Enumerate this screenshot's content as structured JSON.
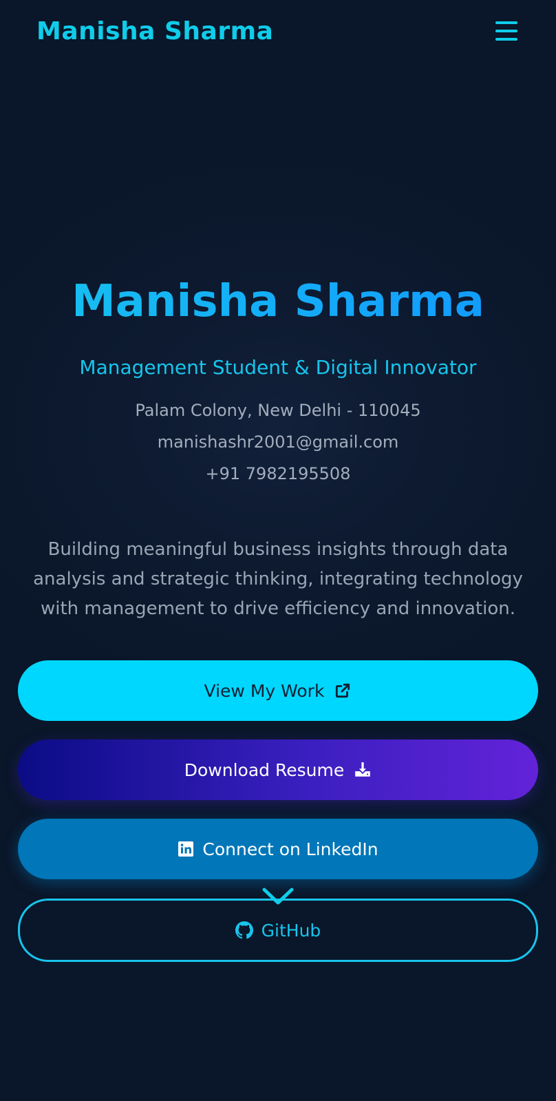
{
  "header": {
    "brand": "Manisha Sharma",
    "menu_icon": "hamburger-menu-icon"
  },
  "hero": {
    "name": "Manisha Sharma",
    "tagline": "Management Student & Digital Innovator",
    "address": "Palam Colony, New Delhi - 110045",
    "email": "manishashr2001@gmail.com",
    "phone": "+91 7982195508",
    "bio": "Building meaningful business insights through data analysis and strategic thinking, integrating technology with management to drive efficiency and innovation."
  },
  "buttons": {
    "view_work": "View My Work",
    "download_resume": "Download Resume",
    "linkedin": "Connect on LinkedIn",
    "github": "GitHub"
  },
  "icons": {
    "view_work": "external-link-icon",
    "download_resume": "download-icon",
    "linkedin": "linkedin-icon",
    "github": "github-icon",
    "scroll": "chevron-down-icon"
  },
  "colors": {
    "background": "#0a1629",
    "accent": "#00d7ff",
    "brand_text": "#0fcdea",
    "linkedin": "#0176b8",
    "resume_gradient_start": "#0b0c86",
    "resume_gradient_end": "#6323d9",
    "muted_text": "#a3adbd"
  }
}
